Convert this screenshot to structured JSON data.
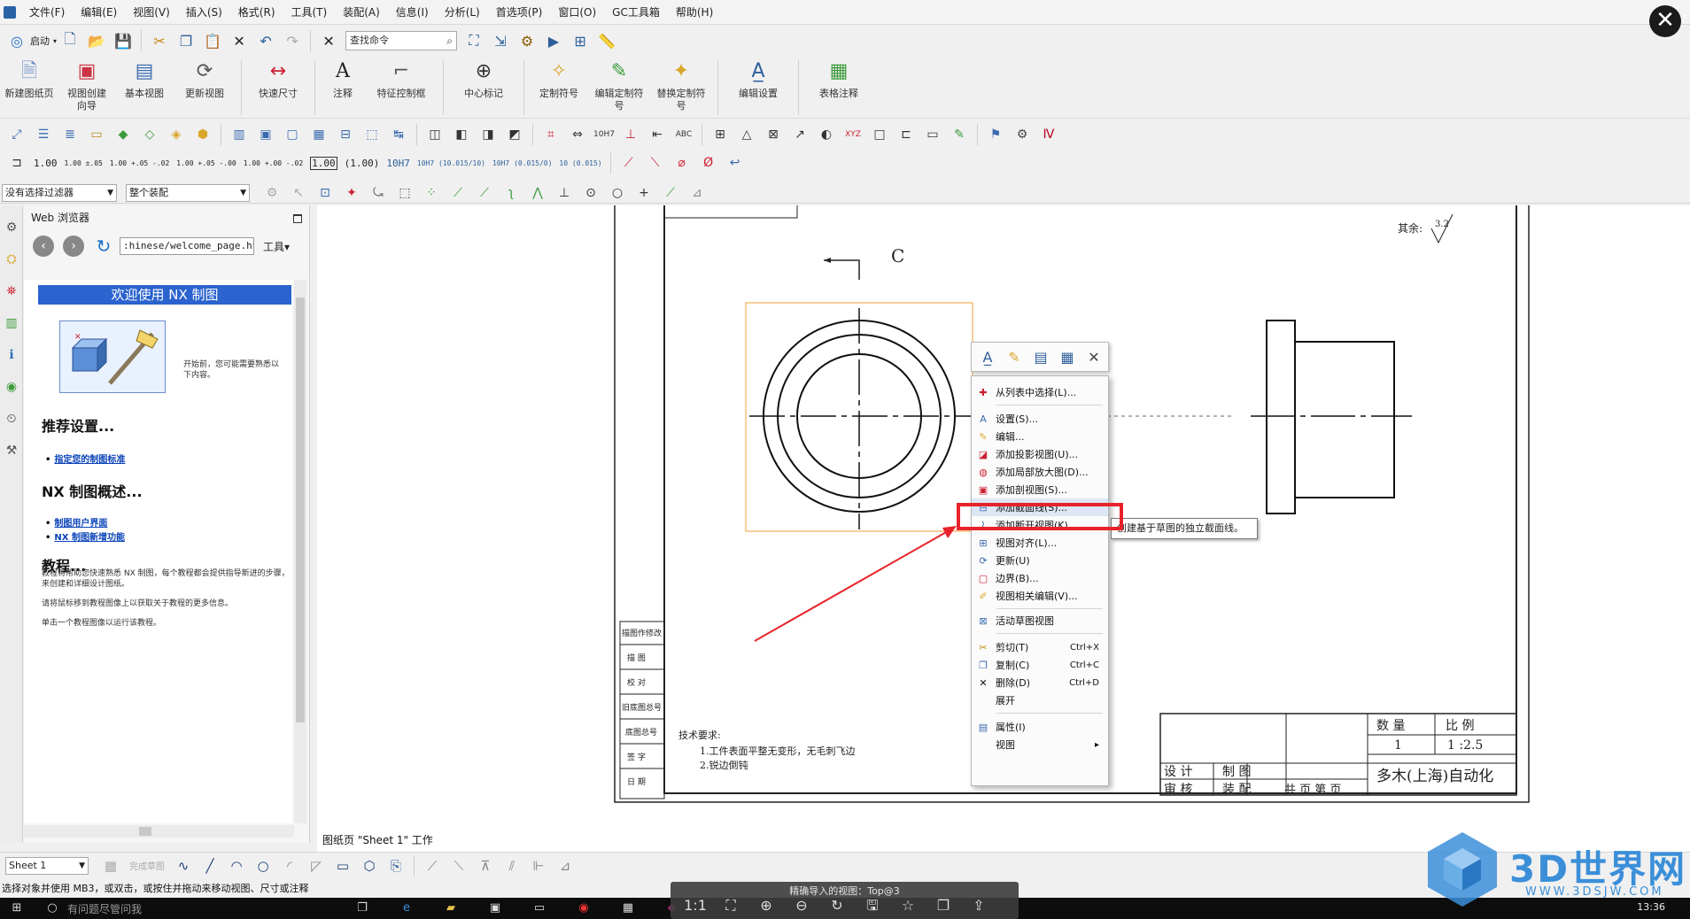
{
  "menu": [
    "文件(F)",
    "编辑(E)",
    "视图(V)",
    "插入(S)",
    "格式(R)",
    "工具(T)",
    "装配(A)",
    "信息(I)",
    "分析(L)",
    "首选项(P)",
    "窗口(O)",
    "GC工具箱",
    "帮助(H)"
  ],
  "toolbar1": {
    "start_label": "启动",
    "command_search": "查找命令"
  },
  "ribbon": {
    "buttons": [
      "新建图纸页",
      "视图创建向导",
      "基本视图",
      "更新视图",
      "快速尺寸",
      "注释",
      "特征控制框",
      "中心标记",
      "定制符号",
      "编辑定制符号",
      "替换定制符号",
      "编辑设置",
      "表格注释"
    ]
  },
  "dimension_bar": [
    "1.00",
    "1.00 ±.05",
    "1.00 +.05 -.02",
    "1.00 +.05 -.00",
    "1.00 +.00 -.02",
    "1.00",
    "(1.00)",
    "10H7",
    "10H7 (10.015/10)",
    "10H7 (0.015/0)",
    "10 (0.015)"
  ],
  "filters": {
    "selection_filter": "没有选择过滤器",
    "scope": "整个装配"
  },
  "web_panel": {
    "title": "Web 浏览器",
    "url": ":hinese/welcome_page.html",
    "tools": "工具▾",
    "welcome_title": "欢迎使用 NX 制图",
    "intro": "开始前，您可能需要熟悉以下内容。",
    "h_settings": "推荐设置...",
    "link_standard": "指定您的制图标准",
    "h_overview": "NX 制图概述...",
    "link_ui": "制图用户界面",
    "link_new": "NX 制图新增功能",
    "h_tutorial": "教程...",
    "tutorial_text": "教程将帮助您快速熟悉 NX 制图，每个教程都会提供指导新进的步骤，来创建和详细设计图纸。",
    "hover_text": "请将鼠标移到教程图像上以获取关于教程的更多信息。",
    "click_text": "单击一个教程图像以运行该教程。"
  },
  "drawing": {
    "section_label": "C",
    "roughness_note": "其余:",
    "roughness_value": "3.2",
    "tech_title": "技术要求:",
    "tech_1": "1.工件表面平整无变形，无毛刺飞边",
    "tech_2": "2.锐边倒钝",
    "title_block": {
      "qty": "数 量",
      "scale_label": "比 例",
      "qty_value": "1",
      "scale_value": "1 :2.5",
      "design": "设 计",
      "drawn": "制 图",
      "check": "审 核",
      "assembly": "装 配",
      "sheets": "共  页  第  页",
      "company": "多木(上海)自动化"
    },
    "side_rows": [
      "描图作修改",
      "描  图",
      "校  对",
      "旧底图总号",
      "底图总号",
      "签  字",
      "日  期"
    ]
  },
  "context_menu": {
    "items": [
      {
        "label": "从列表中选择(L)...",
        "icon": "plus-icon"
      },
      {
        "label": "设置(S)...",
        "icon": "settings-text-icon"
      },
      {
        "label": "编辑...",
        "icon": "edit-icon"
      },
      {
        "label": "添加投影视图(U)...",
        "icon": "projected-view-icon"
      },
      {
        "label": "添加局部放大图(D)...",
        "icon": "detail-view-icon"
      },
      {
        "label": "添加剖视图(S)...",
        "icon": "section-view-icon"
      },
      {
        "label": "添加截面线(S)...",
        "icon": "section-line-icon"
      },
      {
        "label": "添加断开视图(K)...",
        "icon": "break-view-icon"
      },
      {
        "label": "视图对齐(L)...",
        "icon": "align-view-icon"
      },
      {
        "label": "更新(U)",
        "icon": "update-icon"
      },
      {
        "label": "边界(B)...",
        "icon": "boundary-icon"
      },
      {
        "label": "视图相关编辑(V)...",
        "icon": "view-dependent-edit-icon"
      },
      {
        "label": "活动草图视图",
        "icon": "sketch-view-icon"
      },
      {
        "label": "剪切(T)",
        "icon": "cut-icon",
        "shortcut": "Ctrl+X"
      },
      {
        "label": "复制(C)",
        "icon": "copy-icon",
        "shortcut": "Ctrl+C"
      },
      {
        "label": "删除(D)",
        "icon": "delete-icon",
        "shortcut": "Ctrl+D"
      },
      {
        "label": "展开",
        "icon": ""
      },
      {
        "label": "属性(I)",
        "icon": "properties-icon"
      },
      {
        "label": "视图",
        "icon": ""
      }
    ],
    "tooltip": "创建基于草图的独立截面线。"
  },
  "sheet_status": "图纸页 \"Sheet 1\" 工作",
  "bottom": {
    "sheet_select": "Sheet 1",
    "finish_sketch": "完成草图"
  },
  "status_bar": "选择对象并使用 MB3，或双击，或按住并拖动来移动视图、尺寸或注释",
  "overlay": {
    "title": "精确导入的视图：Top@3",
    "zoom": "1:1"
  },
  "taskbar": {
    "search": "有问题尽管问我",
    "time": "13:36"
  },
  "watermark": {
    "text": "3D世界网",
    "url": "WWW.3DSJW.COM"
  }
}
